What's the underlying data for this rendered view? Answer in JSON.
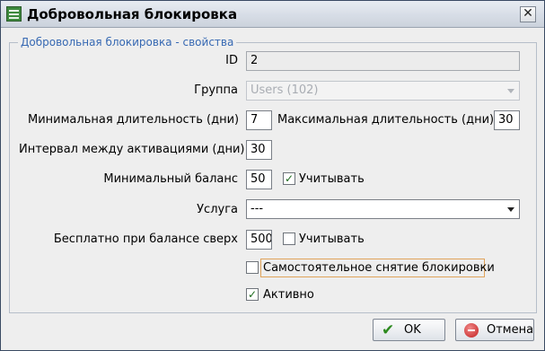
{
  "window": {
    "title": "Добровольная блокировка",
    "close_glyph": "✕",
    "icon": "app-list-icon",
    "close_icon": "close-icon"
  },
  "group": {
    "legend": "Добровольная блокировка - свойства"
  },
  "fields": {
    "id": {
      "label": "ID",
      "value": "2"
    },
    "group": {
      "label": "Группа",
      "value": "Users (102)"
    },
    "min_duration": {
      "label": "Минимальная длительность (дни)",
      "value": "7"
    },
    "max_duration": {
      "label": "Максимальная длительность (дни)",
      "value": "30"
    },
    "interval": {
      "label": "Интервал между активациями (дни)",
      "value": "30"
    },
    "min_balance": {
      "label": "Минимальный баланс",
      "value": "50",
      "check_label": "Учитывать",
      "checked": true
    },
    "service": {
      "label": "Услуга",
      "value": "---"
    },
    "free_above": {
      "label": "Бесплатно при балансе сверх",
      "value": "500",
      "check_label": "Учитывать",
      "checked": false
    },
    "self_unlock": {
      "label": "Самостоятельное снятие блокировки",
      "checked": false
    },
    "active": {
      "label": "Активно",
      "checked": true
    }
  },
  "buttons": {
    "ok": "OK",
    "cancel": "Отмена"
  },
  "colors": {
    "legend": "#3769b3",
    "check": "#1c6a1c",
    "focus": "#e0a35a"
  }
}
